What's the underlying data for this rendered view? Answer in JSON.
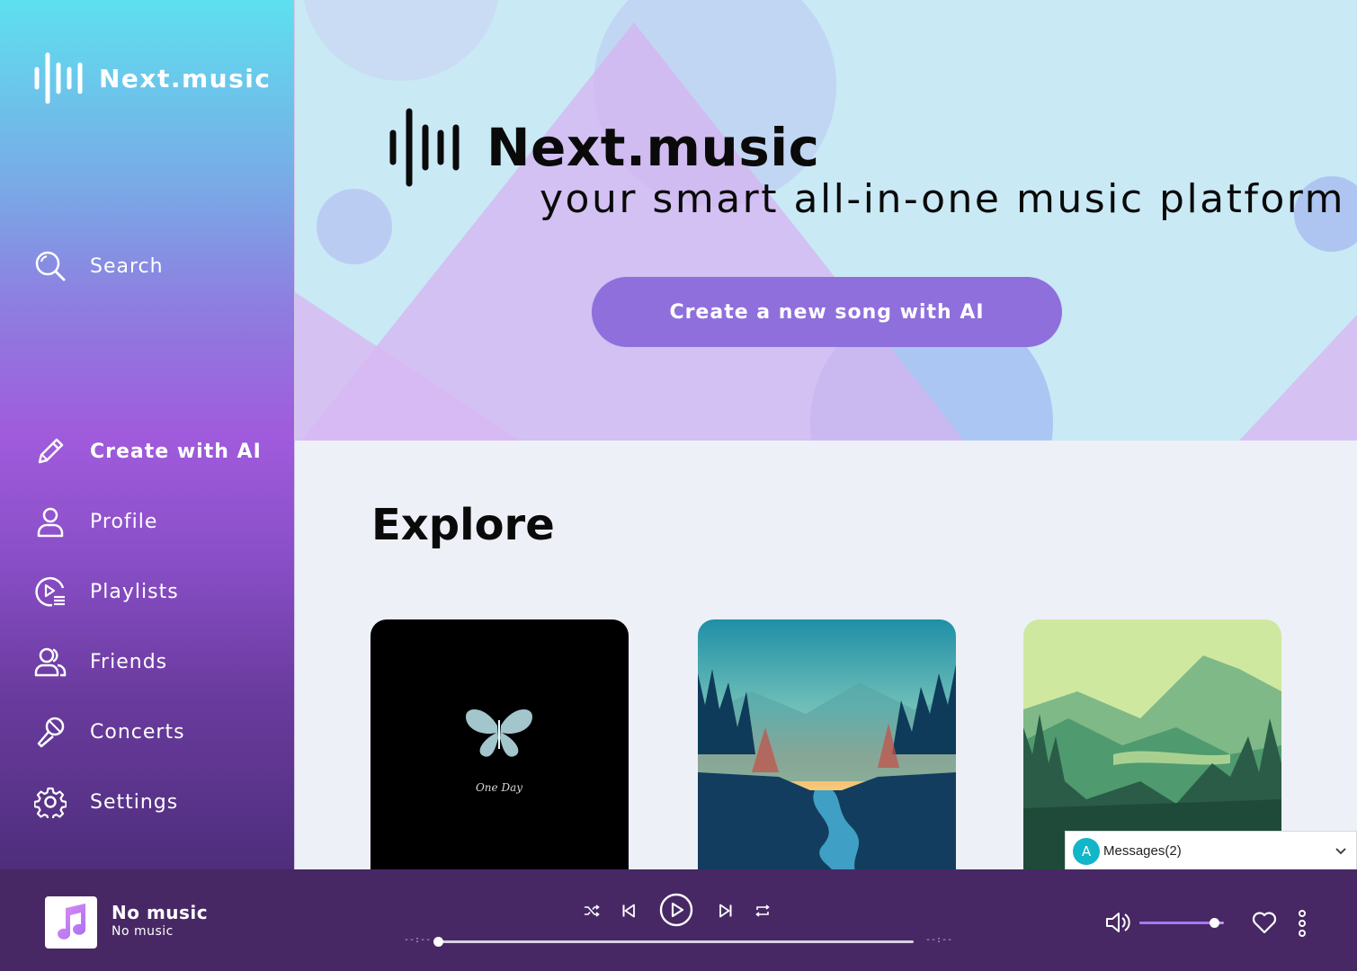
{
  "sidebar": {
    "brand": "Next.music",
    "search_label": "Search",
    "items": [
      {
        "label": "Create with AI",
        "icon": "pencil-icon"
      },
      {
        "label": "Profile",
        "icon": "user-icon"
      },
      {
        "label": "Playlists",
        "icon": "playlist-icon"
      },
      {
        "label": "Friends",
        "icon": "friends-icon"
      },
      {
        "label": "Concerts",
        "icon": "microphone-icon"
      },
      {
        "label": "Settings",
        "icon": "gear-icon"
      }
    ],
    "active_item": "Create with AI"
  },
  "hero": {
    "brand": "Next.music",
    "tagline": "your smart all-in-one music platform",
    "cta_label": "Create a new song with AI"
  },
  "explore": {
    "title": "Explore",
    "cards": [
      {
        "art": "butterfly-dark",
        "art_text": "One Day"
      },
      {
        "art": "forest-sunset-river"
      },
      {
        "art": "green-mountain-valley"
      }
    ]
  },
  "messages": {
    "avatar_letter": "A",
    "label": "Messages(2)"
  },
  "player": {
    "title": "No music",
    "artist": "No music",
    "elapsed": "--:--",
    "duration": "--:--",
    "progress": 0,
    "volume": 0.88
  },
  "colors": {
    "accent": "#8f6fdc",
    "player_bg": "#472864",
    "hero_bg": "#c9e9f5"
  }
}
